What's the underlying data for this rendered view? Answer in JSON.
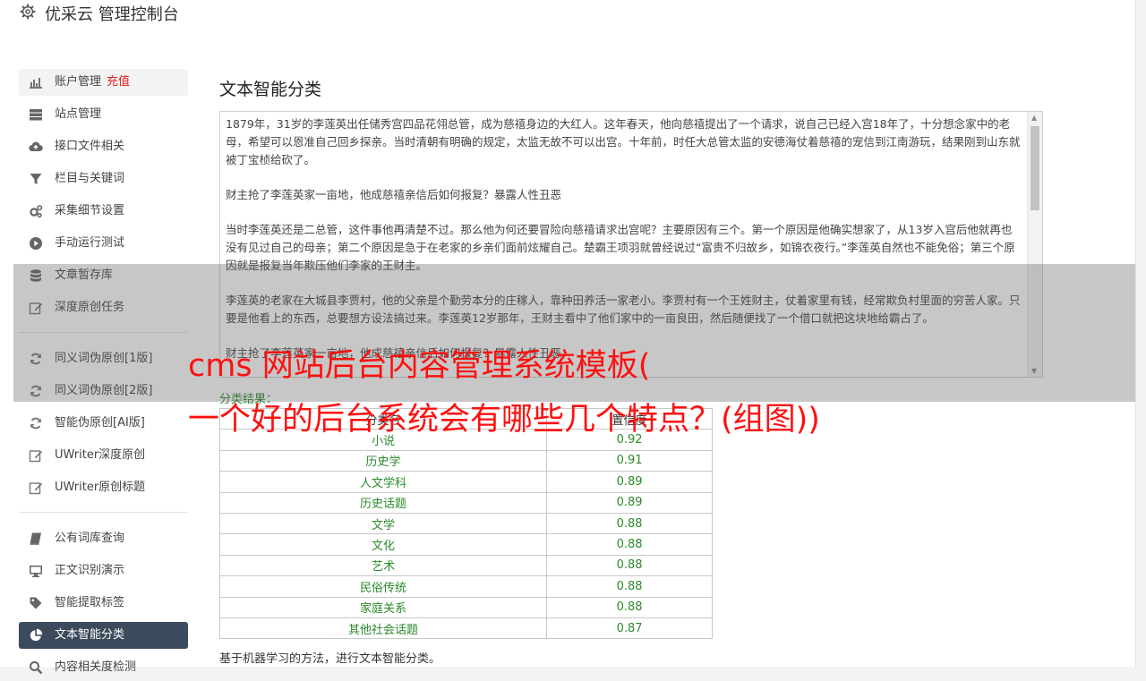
{
  "header": {
    "title": "优采云 管理控制台"
  },
  "sidebar": {
    "items": [
      {
        "label": "账户管理",
        "extra": "充值",
        "icon": "bar-chart-icon"
      },
      {
        "label": "站点管理",
        "icon": "server-icon"
      },
      {
        "label": "接口文件相关",
        "icon": "cloud-upload-icon"
      },
      {
        "label": "栏目与关键词",
        "icon": "filter-icon"
      },
      {
        "label": "采集细节设置",
        "icon": "gears-icon"
      },
      {
        "label": "手动运行测试",
        "icon": "play-icon"
      },
      {
        "label": "文章暂存库",
        "icon": "database-icon"
      },
      {
        "label": "深度原创任务",
        "icon": "edit-icon"
      },
      {
        "label": "同义词伪原创[1版]",
        "icon": "refresh-icon"
      },
      {
        "label": "同义词伪原创[2版]",
        "icon": "refresh-icon"
      },
      {
        "label": "智能伪原创[AI版]",
        "icon": "refresh-icon"
      },
      {
        "label": "UWriter深度原创",
        "icon": "edit-icon"
      },
      {
        "label": "UWriter原创标题",
        "icon": "edit-icon"
      },
      {
        "label": "公有词库查询",
        "icon": "book-icon"
      },
      {
        "label": "正文识别演示",
        "icon": "monitor-icon"
      },
      {
        "label": "智能提取标签",
        "icon": "tag-icon"
      },
      {
        "label": "文本智能分类",
        "icon": "pie-chart-icon"
      },
      {
        "label": "内容相关度检测",
        "icon": "search-icon"
      }
    ]
  },
  "main": {
    "title": "文本智能分类",
    "text_paragraphs": [
      "1879年，31岁的李莲英出任储秀宫四品花翎总管，成为慈禧身边的大红人。这年春天，他向慈禧提出了一个请求，说自己已经入宫18年了，十分想念家中的老母，希望可以恩准自己回乡探亲。当时清朝有明确的规定，太监无故不可以出宫。十年前，时任大总管太监的安德海仗着慈禧的宠信到江南游玩，结果刚到山东就被丁宝桢给砍了。",
      "财主抢了李莲英家一亩地，他成慈禧亲信后如何报复？暴露人性丑恶",
      "当时李莲英还是二总管，这件事他再清楚不过。那么他为何还要冒险向慈禧请求出宫呢？主要原因有三个。第一个原因是他确实想家了，从13岁入宫后他就再也没有见过自己的母亲；第二个原因是急于在老家的乡亲们面前炫耀自己。楚霸王项羽就曾经说过“富贵不归故乡，如锦衣夜行。”李莲英自然也不能免俗；第三个原因就是报复当年欺压他们李家的王财主。",
      "李莲英的老家在大城县李贾村，他的父亲是个勤劳本分的庄稼人，靠种田养活一家老小。李贾村有一个王姓财主，仗着家里有钱，经常欺负村里面的穷苦人家。只要是他看上的东西，总要想方设法搞过来。李莲英12岁那年，王财主看中了他们家中的一亩良田，然后随便找了一个借口就把这块地给霸占了。",
      "财主抢了李莲英家一亩地，他成慈禧亲信后如何报复？暴露人性丑恶"
    ],
    "result_label": "分类结果：",
    "table_headers": [
      "分类名",
      "置信度"
    ],
    "table_rows": [
      [
        "小说",
        "0.92"
      ],
      [
        "历史学",
        "0.91"
      ],
      [
        "人文学科",
        "0.89"
      ],
      [
        "历史话题",
        "0.89"
      ],
      [
        "文学",
        "0.88"
      ],
      [
        "文化",
        "0.88"
      ],
      [
        "艺术",
        "0.88"
      ],
      [
        "民俗传统",
        "0.88"
      ],
      [
        "家庭关系",
        "0.88"
      ],
      [
        "其他社会话题",
        "0.87"
      ]
    ],
    "footnote": "基于机器学习的方法，进行文本智能分类。"
  },
  "overlay": {
    "line1": "cms 网站后台内容管理系统模板(",
    "line2": "一个好的后台系统会有哪些几个特点？(组图))"
  },
  "colors": {
    "active_nav_bg": "#3b4a5c",
    "result_green": "#2a8a2a",
    "recharge_red": "#e02020",
    "overlay_red": "#ff1010"
  }
}
